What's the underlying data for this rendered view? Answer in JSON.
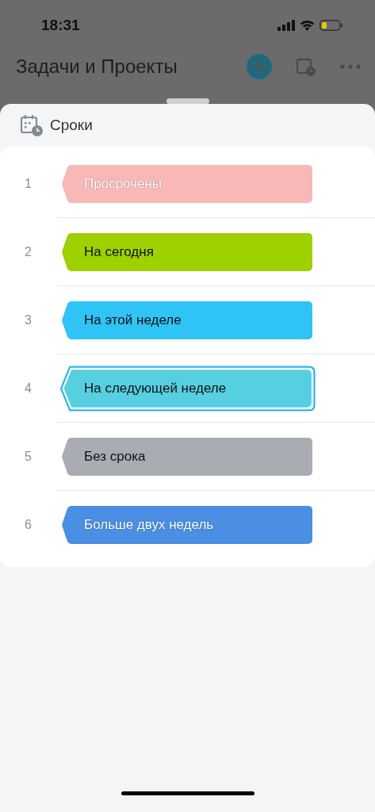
{
  "status_bar": {
    "time": "18:31"
  },
  "header": {
    "title": "Задачи и Проекты"
  },
  "sheet": {
    "title": "Сроки",
    "items": [
      {
        "number": "1",
        "label": "Просрочены",
        "color": "#f9b8b8",
        "light_text": true,
        "selected": false
      },
      {
        "number": "2",
        "label": "На сегодня",
        "color": "#9fd000",
        "light_text": false,
        "selected": false
      },
      {
        "number": "3",
        "label": "На этой неделе",
        "color": "#2fc4f5",
        "light_text": false,
        "selected": false
      },
      {
        "number": "4",
        "label": "На следующей неделе",
        "color": "#56d0e0",
        "light_text": false,
        "selected": true
      },
      {
        "number": "5",
        "label": "Без срока",
        "color": "#a9adb3",
        "light_text": false,
        "selected": false
      },
      {
        "number": "6",
        "label": "Больше двух недель",
        "color": "#4a8fe3",
        "light_text": true,
        "selected": false
      }
    ]
  }
}
